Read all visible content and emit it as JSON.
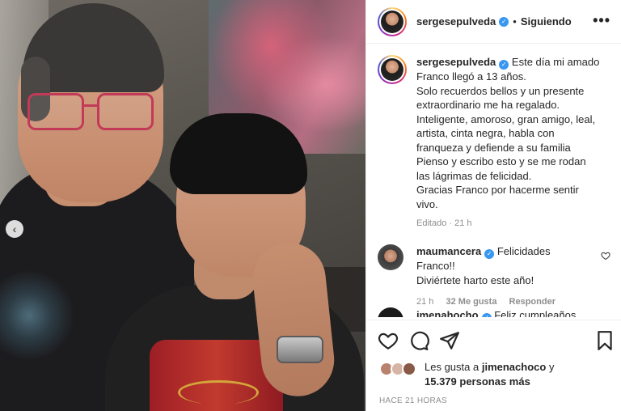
{
  "post": {
    "username": "sergesepulveda",
    "separator": "•",
    "follow_state": "Siguiendo",
    "more_label": "•••",
    "caption_lines": [
      "Este día mi amado",
      "Franco llegó a 13 años.",
      "Solo recuerdos bellos y un presente",
      "extraordinario me ha regalado.",
      "Inteligente, amoroso, gran amigo, leal,",
      "artista, cinta negra, habla con",
      "franqueza y defiende a su familia",
      "Pienso y escribo esto y se me rodan",
      "las lágrimas de felicidad.",
      "Gracias Franco por hacermе sentir",
      "vivo."
    ],
    "caption_meta": "Editado · 21 h",
    "carousel_prev": "‹"
  },
  "comments": [
    {
      "username": "maumancera",
      "lines": [
        "Felicidades Franco!!",
        "Diviértete harto este año!"
      ],
      "age": "21 h",
      "likes": "32 Me gusta",
      "reply": "Responder"
    },
    {
      "username": "jmenahocho",
      "text": "Feliz cumpleaños"
    }
  ],
  "likes": {
    "prefix": "Les gusta a",
    "name": "jimenachoco",
    "joiner": "y",
    "count": "15.379 personas más"
  },
  "timestamp": "HACE 21 HORAS",
  "colors": {
    "verified": "#3897f0",
    "muted": "#8e8e8e",
    "text": "#262626"
  },
  "icons": [
    "verified-badge-icon",
    "more-icon",
    "heart-icon",
    "comment-icon",
    "share-icon",
    "bookmark-icon",
    "chevron-left-icon"
  ]
}
